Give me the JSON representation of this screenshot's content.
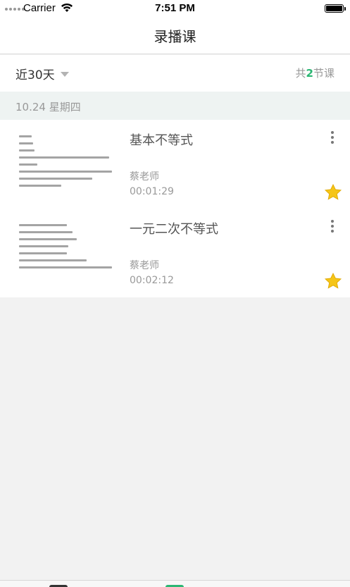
{
  "status_bar": {
    "carrier": "Carrier",
    "time": "7:51 PM"
  },
  "nav": {
    "title": "录播课"
  },
  "filter": {
    "period": "近30天",
    "total_prefix": "共",
    "total_count": "2",
    "total_suffix": "节课"
  },
  "date_header": "10.24 星期四",
  "lessons": [
    {
      "title": "基本不等式",
      "teacher": "蔡老师",
      "duration": "00:01:29",
      "starred": true,
      "thumbnail_lines": 8
    },
    {
      "title": "一元二次不等式",
      "teacher": "蔡老师",
      "duration": "00:02:12",
      "starred": true,
      "thumbnail_lines": 8
    }
  ],
  "colors": {
    "accent": "#2bb673",
    "star": "#f5c518",
    "date_band": "#eef3f2"
  },
  "icons": {
    "signal": "signal-icon",
    "wifi": "wifi-icon",
    "battery": "battery-icon",
    "dropdown": "triangle-down-icon",
    "more": "more-vertical-icon",
    "star": "star-icon"
  }
}
